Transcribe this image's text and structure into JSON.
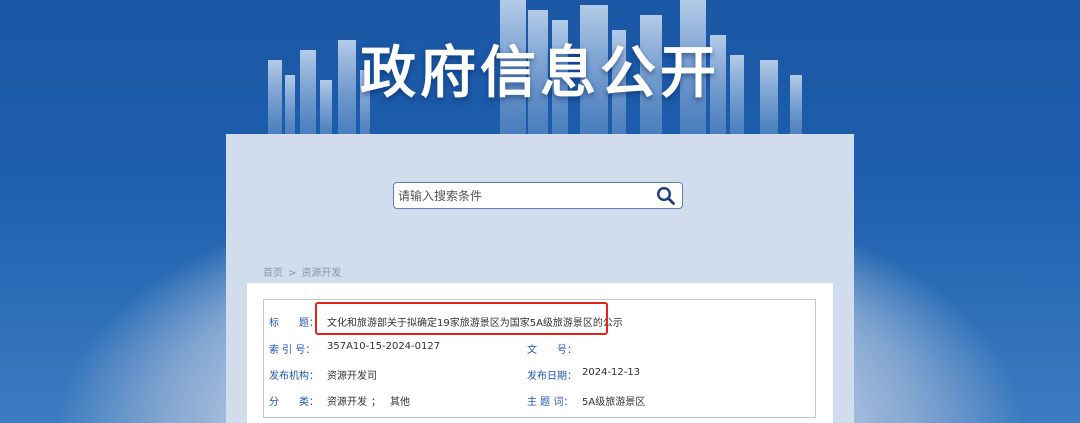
{
  "header": {
    "site_title": "政府信息公开"
  },
  "search": {
    "placeholder": "请输入搜索条件"
  },
  "breadcrumb": {
    "home": "首页",
    "separator": ">",
    "current": "资源开发"
  },
  "info": {
    "title_label": "标　　题：",
    "title_value": "文化和旅游部关于拟确定19家旅游景区为国家5A级旅游景区的公示",
    "index_label": "索 引 号：",
    "index_value": "357A10-15-2024-0127",
    "doc_no_label": "文　　号：",
    "doc_no_value": "",
    "publisher_label": "发布机构：",
    "publisher_value": "资源开发司",
    "date_label": "发布日期：",
    "date_value": "2024-12-13",
    "category_label": "分　　类：",
    "category_value_1": "资源开发",
    "category_sep": "；",
    "category_value_2": "其他",
    "keywords_label": "主 题 词：",
    "keywords_value": "5A级旅游景区"
  },
  "colors": {
    "label_blue": "#1f57b0",
    "highlight_red": "#e2231a",
    "header_blue": "#1b57a5"
  },
  "icons": {
    "search": "search-icon"
  }
}
